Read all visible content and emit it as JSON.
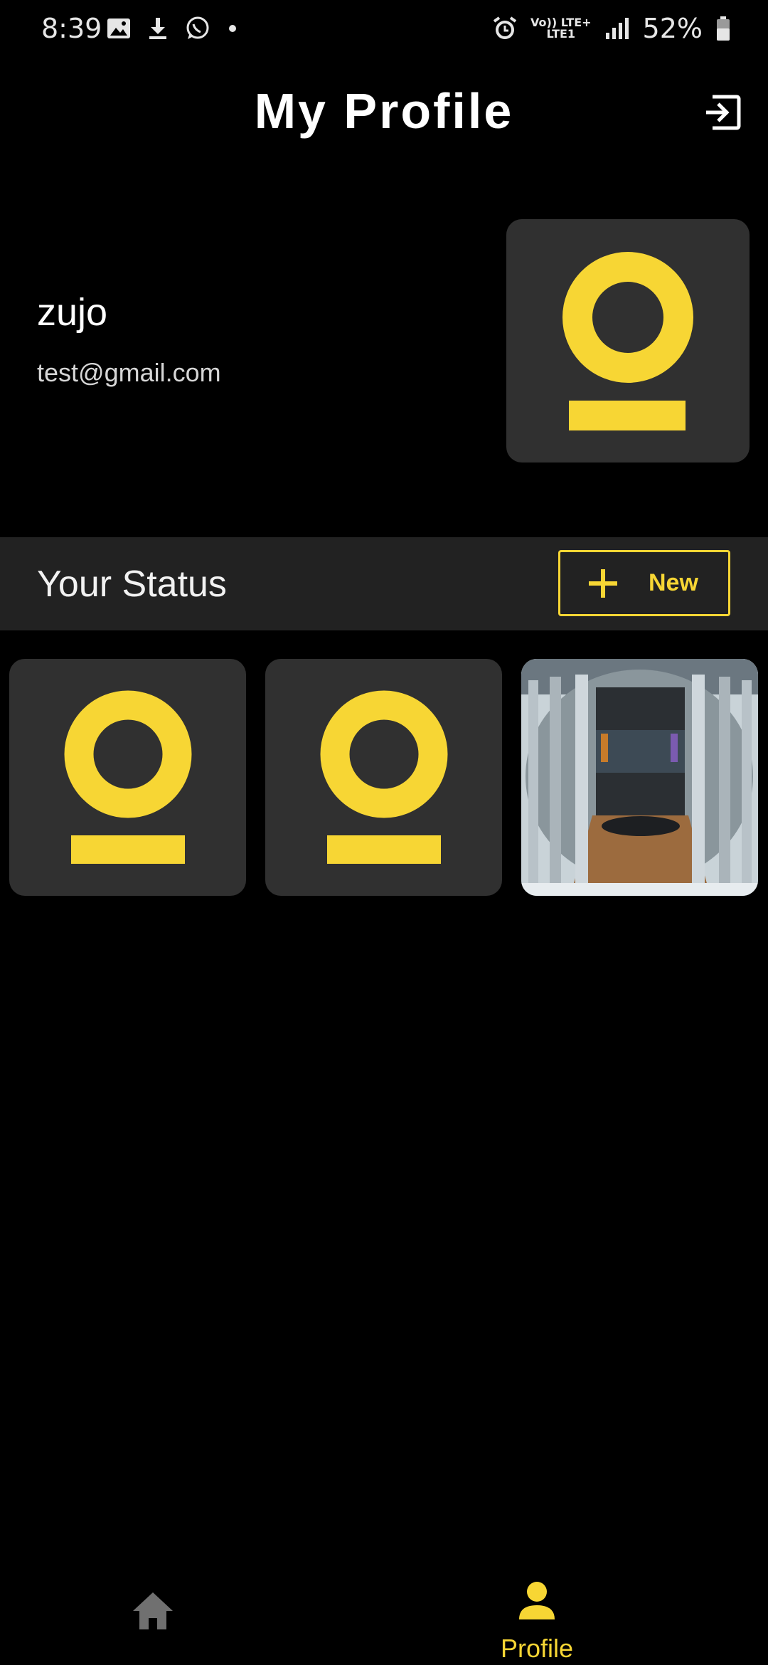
{
  "status_bar": {
    "time": "8:39",
    "battery": "52%",
    "network_line1": "Vo)) LTE+",
    "network_line2": "LTE1",
    "icons_left": [
      "image-icon",
      "download-icon",
      "whatsapp-icon",
      "dot-icon"
    ],
    "icons_right": [
      "alarm-icon",
      "signal-icon",
      "battery-icon"
    ]
  },
  "header": {
    "title": "My Profile",
    "logout_icon": "logout-icon"
  },
  "profile": {
    "name": "zujo",
    "email": "test@gmail.com"
  },
  "status_section": {
    "title": "Your Status",
    "new_button_label": "New"
  },
  "status_items": [
    {
      "kind": "avatar-placeholder"
    },
    {
      "kind": "avatar-placeholder"
    },
    {
      "kind": "photo"
    }
  ],
  "bottom_nav": {
    "items": [
      {
        "label": "",
        "icon": "home-icon",
        "active": false
      },
      {
        "label": "Profile",
        "icon": "person-icon",
        "active": true
      }
    ]
  },
  "colors": {
    "accent": "#f7d634",
    "background": "#000000",
    "tile": "#303030",
    "band": "#222222"
  }
}
